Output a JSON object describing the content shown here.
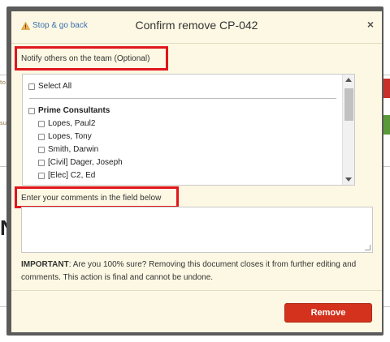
{
  "dialog": {
    "title": "Confirm remove CP-042",
    "back_link": "Stop & go back",
    "close_symbol": "×",
    "back_icon": "warning-icon",
    "accent_color": "#e0161b",
    "background_color": "#fcf8e3"
  },
  "notify": {
    "label": "Notify others on the team (Optional)",
    "select_all": "Select All",
    "group_name": "Prime Consultants",
    "members": [
      "Lopes, Paul2",
      "Lopes, Tony",
      "Smith, Darwin",
      "[Civil] Dager, Joseph",
      "[Elec] C2, Ed"
    ]
  },
  "comments": {
    "label": "Enter your comments in the field below",
    "value": ""
  },
  "warning": {
    "strong": "IMPORTANT",
    "text": ": Are you 100% sure? Removing this document closes it from further editing and comments. This action is final and cannot be undone."
  },
  "actions": {
    "remove_label": "Remove",
    "remove_color": "#d4321c"
  },
  "background": {
    "left_text_1": "to",
    "left_text_2": "sub",
    "left_text_3": "N"
  }
}
